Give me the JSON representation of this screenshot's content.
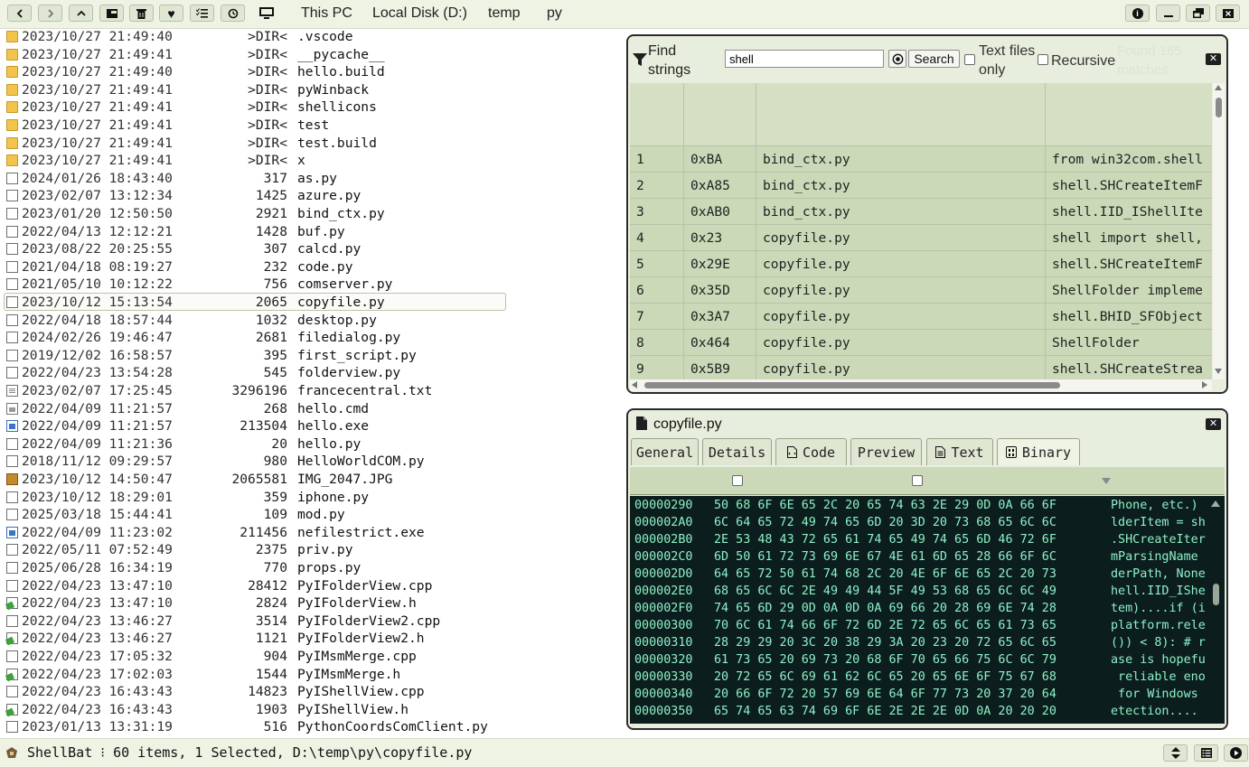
{
  "toolbar": {
    "breadcrumbs": [
      "This PC",
      "Local Disk (D:)",
      "temp",
      "py"
    ],
    "nav_buttons": [
      "back",
      "forward",
      "up",
      "desktop",
      "delete",
      "favorites",
      "checklist",
      "history"
    ],
    "window_buttons": [
      "info",
      "minimize",
      "restore",
      "close"
    ]
  },
  "files": [
    {
      "date": "2023/10/27 21:49:40",
      "size": ">DIR<",
      "name": ".vscode",
      "icon": "folder-icon"
    },
    {
      "date": "2023/10/27 21:49:41",
      "size": ">DIR<",
      "name": "__pycache__",
      "icon": "folder-icon"
    },
    {
      "date": "2023/10/27 21:49:40",
      "size": ">DIR<",
      "name": "hello.build",
      "icon": "folder-icon"
    },
    {
      "date": "2023/10/27 21:49:41",
      "size": ">DIR<",
      "name": "pyWinback",
      "icon": "folder-icon"
    },
    {
      "date": "2023/10/27 21:49:41",
      "size": ">DIR<",
      "name": "shellicons",
      "icon": "folder-icon"
    },
    {
      "date": "2023/10/27 21:49:41",
      "size": ">DIR<",
      "name": "test",
      "icon": "folder-icon"
    },
    {
      "date": "2023/10/27 21:49:41",
      "size": ">DIR<",
      "name": "test.build",
      "icon": "folder-icon"
    },
    {
      "date": "2023/10/27 21:49:41",
      "size": ">DIR<",
      "name": "x",
      "icon": "folder-icon"
    },
    {
      "date": "2024/01/26 18:43:40",
      "size": "317",
      "name": "as.py",
      "icon": "file-icon"
    },
    {
      "date": "2023/02/07 13:12:34",
      "size": "1425",
      "name": "azure.py",
      "icon": "file-icon"
    },
    {
      "date": "2023/01/20 12:50:50",
      "size": "2921",
      "name": "bind_ctx.py",
      "icon": "file-icon"
    },
    {
      "date": "2022/04/13 12:12:21",
      "size": "1428",
      "name": "buf.py",
      "icon": "file-icon"
    },
    {
      "date": "2023/08/22 20:25:55",
      "size": "307",
      "name": "calcd.py",
      "icon": "file-icon"
    },
    {
      "date": "2021/04/18 08:19:27",
      "size": "232",
      "name": "code.py",
      "icon": "file-icon"
    },
    {
      "date": "2021/05/10 10:12:22",
      "size": "756",
      "name": "comserver.py",
      "icon": "file-icon"
    },
    {
      "date": "2023/10/12 15:13:54",
      "size": "2065",
      "name": "copyfile.py",
      "icon": "file-icon",
      "selected": true
    },
    {
      "date": "2022/04/18 18:57:44",
      "size": "1032",
      "name": "desktop.py",
      "icon": "file-icon"
    },
    {
      "date": "2024/02/26 19:46:47",
      "size": "2681",
      "name": "filedialog.py",
      "icon": "file-icon"
    },
    {
      "date": "2019/12/02 16:58:57",
      "size": "395",
      "name": "first_script.py",
      "icon": "file-icon"
    },
    {
      "date": "2022/04/23 13:54:28",
      "size": "545",
      "name": "folderview.py",
      "icon": "file-icon"
    },
    {
      "date": "2023/02/07 17:25:45",
      "size": "3296196",
      "name": "francecentral.txt",
      "icon": "text-file-icon"
    },
    {
      "date": "2022/04/09 11:21:57",
      "size": "268",
      "name": "hello.cmd",
      "icon": "cmd-file-icon"
    },
    {
      "date": "2022/04/09 11:21:57",
      "size": "213504",
      "name": "hello.exe",
      "icon": "exe-file-icon"
    },
    {
      "date": "2022/04/09 11:21:36",
      "size": "20",
      "name": "hello.py",
      "icon": "file-icon"
    },
    {
      "date": "2018/11/12 09:29:57",
      "size": "980",
      "name": "HelloWorldCOM.py",
      "icon": "file-icon"
    },
    {
      "date": "2023/10/12 14:50:47",
      "size": "2065581",
      "name": "IMG_2047.JPG",
      "icon": "image-file-icon"
    },
    {
      "date": "2023/10/12 18:29:01",
      "size": "359",
      "name": "iphone.py",
      "icon": "file-icon"
    },
    {
      "date": "2025/03/18 15:44:41",
      "size": "109",
      "name": "mod.py",
      "icon": "file-icon"
    },
    {
      "date": "2022/04/09 11:23:02",
      "size": "211456",
      "name": "nefilestrict.exe",
      "icon": "exe-file-icon"
    },
    {
      "date": "2022/05/11 07:52:49",
      "size": "2375",
      "name": "priv.py",
      "icon": "file-icon"
    },
    {
      "date": "2025/06/28 16:34:19",
      "size": "770",
      "name": "props.py",
      "icon": "file-icon"
    },
    {
      "date": "2022/04/23 13:47:10",
      "size": "28412",
      "name": "PyIFolderView.cpp",
      "icon": "file-icon"
    },
    {
      "date": "2022/04/23 13:47:10",
      "size": "2824",
      "name": "PyIFolderView.h",
      "icon": "header-file-icon"
    },
    {
      "date": "2022/04/23 13:46:27",
      "size": "3514",
      "name": "PyIFolderView2.cpp",
      "icon": "file-icon"
    },
    {
      "date": "2022/04/23 13:46:27",
      "size": "1121",
      "name": "PyIFolderView2.h",
      "icon": "header-file-icon"
    },
    {
      "date": "2022/04/23 17:05:32",
      "size": "904",
      "name": "PyIMsmMerge.cpp",
      "icon": "file-icon"
    },
    {
      "date": "2022/04/23 17:02:03",
      "size": "1544",
      "name": "PyIMsmMerge.h",
      "icon": "header-file-icon"
    },
    {
      "date": "2022/04/23 16:43:43",
      "size": "14823",
      "name": "PyIShellView.cpp",
      "icon": "file-icon"
    },
    {
      "date": "2022/04/23 16:43:43",
      "size": "1903",
      "name": "PyIShellView.h",
      "icon": "header-file-icon"
    },
    {
      "date": "2023/01/13 13:31:19",
      "size": "516",
      "name": "PythonCoordsComClient.py",
      "icon": "file-icon"
    }
  ],
  "find_panel": {
    "title": "Find strings",
    "search_value": "shell",
    "search_button": "Search",
    "text_files_only_label": "Text files only",
    "recursive_label": "Recursive",
    "found_text": "Found 165 matches",
    "rows": [
      {
        "n": "1",
        "offset": "0xBA",
        "file": "bind_ctx.py",
        "text": "from win32com.shell"
      },
      {
        "n": "2",
        "offset": "0xA85",
        "file": "bind_ctx.py",
        "text": "shell.SHCreateItemF"
      },
      {
        "n": "3",
        "offset": "0xAB0",
        "file": "bind_ctx.py",
        "text": "shell.IID_IShellIte"
      },
      {
        "n": "4",
        "offset": "0x23",
        "file": "copyfile.py",
        "text": "shell import shell,"
      },
      {
        "n": "5",
        "offset": "0x29E",
        "file": "copyfile.py",
        "text": "shell.SHCreateItemF"
      },
      {
        "n": "6",
        "offset": "0x35D",
        "file": "copyfile.py",
        "text": "ShellFolder impleme"
      },
      {
        "n": "7",
        "offset": "0x3A7",
        "file": "copyfile.py",
        "text": "shell.BHID_SFObject"
      },
      {
        "n": "8",
        "offset": "0x464",
        "file": "copyfile.py",
        "text": "ShellFolder"
      },
      {
        "n": "9",
        "offset": "0x5B9",
        "file": "copyfile.py",
        "text": "shell.SHCreateStrea"
      }
    ]
  },
  "preview_panel": {
    "title": "copyfile.py",
    "tabs": [
      "General",
      "Details",
      "Code",
      "Preview",
      "Text",
      "Binary"
    ],
    "active_tab": "Binary",
    "hex_rows": [
      {
        "offset": "00000290",
        "bytes": "50 68 6F 6E 65 2C 20 65 74 63 2E 29 0D 0A 66 6F",
        "ascii": "Phone, etc.)"
      },
      {
        "offset": "000002A0",
        "bytes": "6C 64 65 72 49 74 65 6D 20 3D 20 73 68 65 6C 6C",
        "ascii": "lderItem = sh"
      },
      {
        "offset": "000002B0",
        "bytes": "2E 53 48 43 72 65 61 74 65 49 74 65 6D 46 72 6F",
        "ascii": ".SHCreateIter"
      },
      {
        "offset": "000002C0",
        "bytes": "6D 50 61 72 73 69 6E 67 4E 61 6D 65 28 66 6F 6C",
        "ascii": "mParsingName"
      },
      {
        "offset": "000002D0",
        "bytes": "64 65 72 50 61 74 68 2C 20 4E 6F 6E 65 2C 20 73",
        "ascii": "derPath, None"
      },
      {
        "offset": "000002E0",
        "bytes": "68 65 6C 6C 2E 49 49 44 5F 49 53 68 65 6C 6C 49",
        "ascii": "hell.IID_IShe"
      },
      {
        "offset": "000002F0",
        "bytes": "74 65 6D 29 0D 0A 0D 0A 69 66 20 28 69 6E 74 28",
        "ascii": "tem)....if (i"
      },
      {
        "offset": "00000300",
        "bytes": "70 6C 61 74 66 6F 72 6D 2E 72 65 6C 65 61 73 65",
        "ascii": "platform.rele"
      },
      {
        "offset": "00000310",
        "bytes": "28 29 29 20 3C 20 38 29 3A 20 23 20 72 65 6C 65",
        "ascii": "()) < 8): # r"
      },
      {
        "offset": "00000320",
        "bytes": "61 73 65 20 69 73 20 68 6F 70 65 66 75 6C 6C 79",
        "ascii": "ase is hopefu"
      },
      {
        "offset": "00000330",
        "bytes": "20 72 65 6C 69 61 62 6C 65 20 65 6E 6F 75 67 68",
        "ascii": " reliable eno"
      },
      {
        "offset": "00000340",
        "bytes": "20 66 6F 72 20 57 69 6E 64 6F 77 73 20 37 20 64",
        "ascii": " for Windows "
      },
      {
        "offset": "00000350",
        "bytes": "65 74 65 63 74 69 6F 6E 2E 2E 2E 0D 0A 20 20 20",
        "ascii": "etection...."
      }
    ]
  },
  "statusbar": {
    "text": "ShellBat ⁝ 60 items, 1 Selected, D:\\temp\\py\\copyfile.py"
  }
}
